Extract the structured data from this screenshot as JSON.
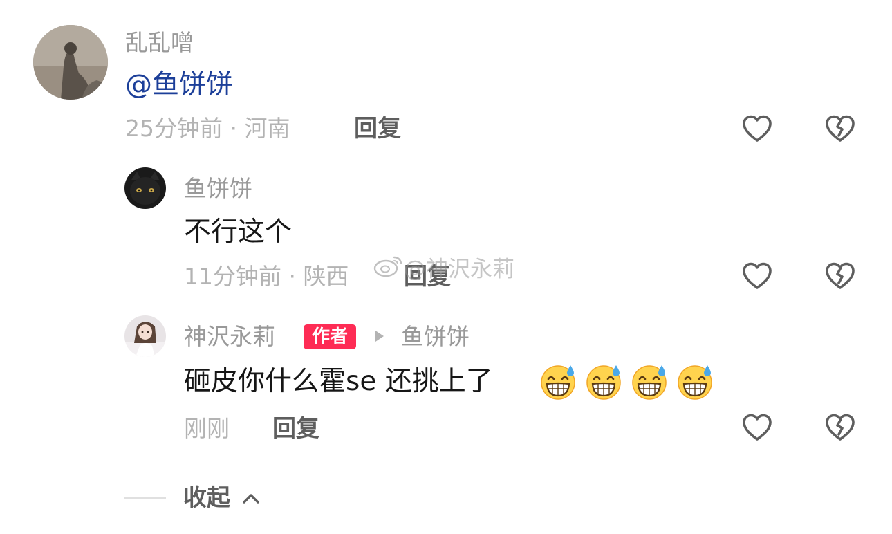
{
  "comment_main": {
    "username": "乱乱噌",
    "mention": "@鱼饼饼",
    "time_location": "25分钟前 · 河南",
    "reply_label": "回复"
  },
  "replies": [
    {
      "username": "鱼饼饼",
      "content": "不行这个",
      "time_location": "11分钟前 · 陕西",
      "reply_label": "回复"
    },
    {
      "username": "神沢永莉",
      "author_badge": "作者",
      "reply_to": "鱼饼饼",
      "content": "砸皮你什么霍se 还挑上了",
      "emojis": [
        "grinning-sweat-emoji",
        "grinning-sweat-emoji",
        "grinning-sweat-emoji",
        "grinning-sweat-emoji"
      ],
      "time_location": "刚刚",
      "reply_label": "回复"
    }
  ],
  "watermark": "@神沢永莉",
  "collapse_label": "收起",
  "icons": {
    "like": "heart-outline-icon",
    "dislike": "broken-heart-outline-icon",
    "collapse": "chevron-up-icon",
    "reply_arrow": "triangle-right-icon"
  },
  "colors": {
    "mention": "#1c3f99",
    "author_badge": "#fe2c55",
    "meta_text": "#b3b3b3",
    "username": "#999999"
  }
}
